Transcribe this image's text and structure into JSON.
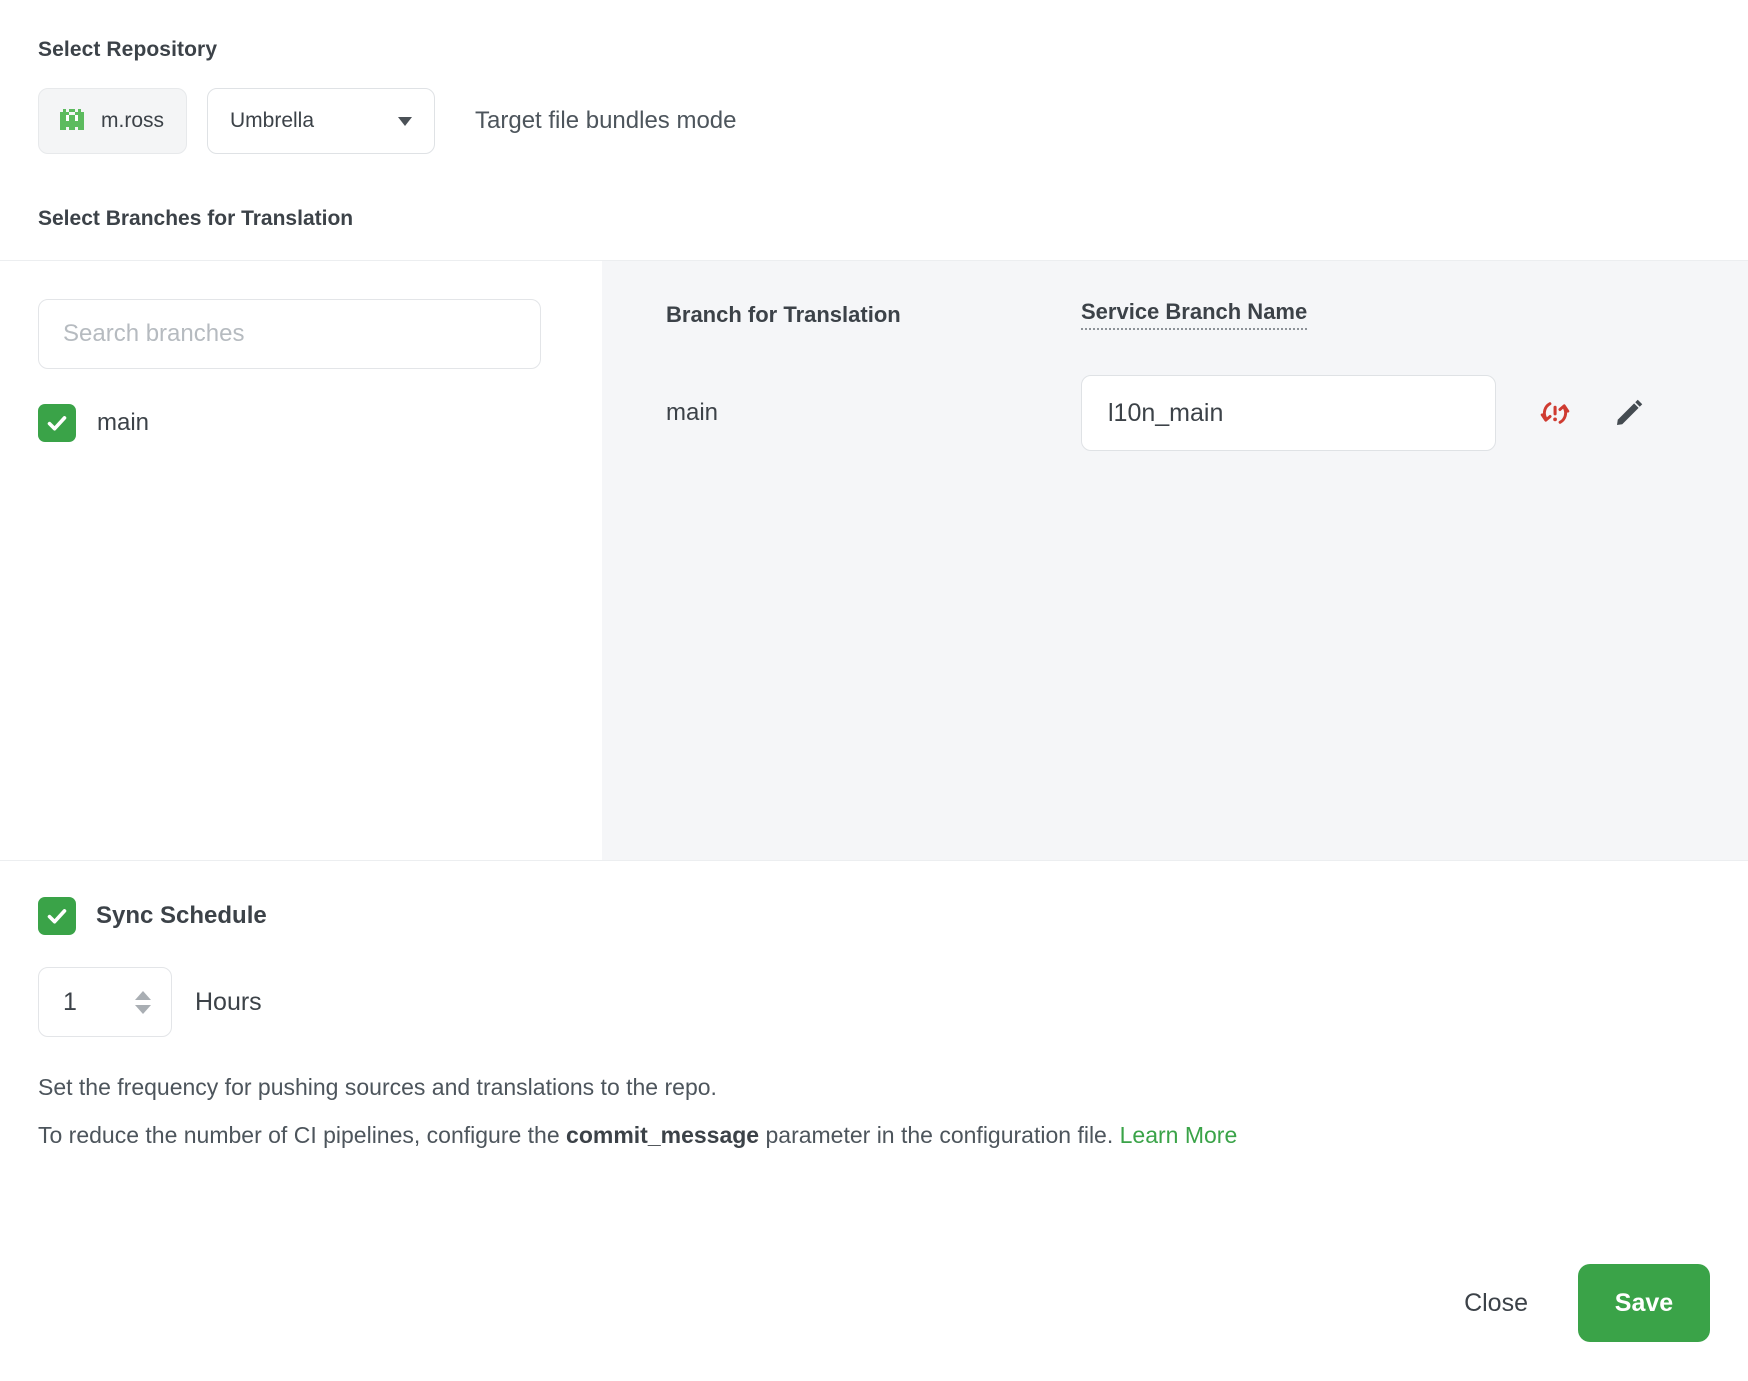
{
  "repository": {
    "section_label": "Select Repository",
    "user_chip": {
      "name": "m.ross",
      "avatar_icon": "identicon-invader-icon"
    },
    "repo_dropdown": {
      "selected": "Umbrella",
      "caret_icon": "chevron-down-icon"
    },
    "mode_text": "Target file bundles mode"
  },
  "branches": {
    "section_label": "Select Branches for Translation",
    "search": {
      "placeholder": "Search branches",
      "value": ""
    },
    "list": [
      {
        "label": "main",
        "checked": true
      }
    ],
    "table": {
      "headers": {
        "branch": "Branch for Translation",
        "service": "Service Branch Name"
      },
      "rows": [
        {
          "branch": "main",
          "service_branch_value": "l10n_main",
          "status_icon": "sync-error-icon",
          "edit_icon": "pencil-icon"
        }
      ]
    }
  },
  "sync_schedule": {
    "title": "Sync Schedule",
    "checked": true,
    "frequency_value": "1",
    "unit_label": "Hours",
    "helper_line_1": "Set the frequency for pushing sources and translations to the repo.",
    "helper_line_2_prefix": "To reduce the number of CI pipelines, configure the ",
    "helper_line_2_code": "commit_message",
    "helper_line_2_suffix": " parameter in the configuration file. ",
    "helper_line_2_link": "Learn More"
  },
  "footer": {
    "close_label": "Close",
    "save_label": "Save"
  },
  "colors": {
    "brand_green": "#3aa348",
    "error_red": "#cf3b31",
    "panel_gray": "#f5f6f8",
    "text_dark": "#3c4248"
  }
}
